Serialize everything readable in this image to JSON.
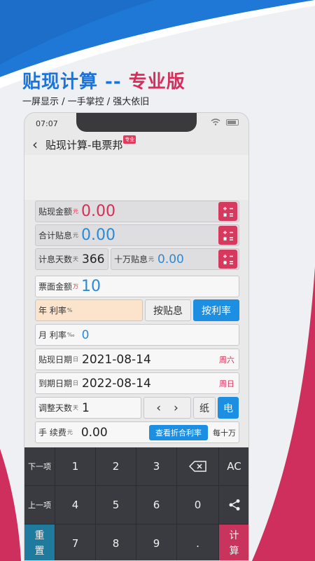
{
  "promo": {
    "headline_main": "贴现计算 -- ",
    "headline_accent": "专业版",
    "subline": "一屏显示 / 一手掌控 / 强大依旧"
  },
  "status_bar": {
    "time": "07:07"
  },
  "app": {
    "title": "贴现计算-电票邦",
    "badge": "专业"
  },
  "results": {
    "discount_amount": {
      "label": "贴现金额",
      "unit": "元",
      "value": "0.00"
    },
    "total_interest": {
      "label": "合计贴息",
      "unit": "元",
      "value": "0.00"
    },
    "interest_days": {
      "label": "计息天数",
      "unit": "天",
      "value": "366"
    },
    "per_100k_interest": {
      "label": "十万贴息",
      "unit": "元",
      "value": "0.00"
    }
  },
  "form": {
    "face_amount": {
      "label": "票面金额",
      "unit": "万",
      "value": "10"
    },
    "annual_rate": {
      "label": "年 利率",
      "unit": "%"
    },
    "mode_by_interest": "按贴息",
    "mode_by_rate": "按利率",
    "monthly_rate": {
      "label": "月 利率",
      "unit": "‰",
      "value": "0"
    },
    "discount_date": {
      "label": "贴现日期",
      "unit": "日",
      "value": "2021-08-14",
      "weekday": "周六"
    },
    "maturity_date": {
      "label": "到期日期",
      "unit": "日",
      "value": "2022-08-14",
      "weekday": "周日"
    },
    "adjust_days": {
      "label": "调整天数",
      "unit": "天",
      "value": "1",
      "paper": "纸",
      "electronic": "电"
    },
    "fee": {
      "label": "手 续费",
      "unit": "元",
      "value": "0.00",
      "view_rate_button": "查看折合利率",
      "per": "每十万"
    }
  },
  "keypad": {
    "next": "下一项",
    "prev": "上一项",
    "k1": "1",
    "k2": "2",
    "k3": "3",
    "k4": "4",
    "k5": "5",
    "k6": "6",
    "k0": "0",
    "k7": "7",
    "k8": "8",
    "k9": "9",
    "dot": ".",
    "ac": "AC",
    "reset": [
      "重",
      "置"
    ],
    "calc": [
      "计",
      "算"
    ]
  },
  "colors": {
    "brand_blue": "#1d8fe3",
    "brand_red": "#d52f57"
  }
}
